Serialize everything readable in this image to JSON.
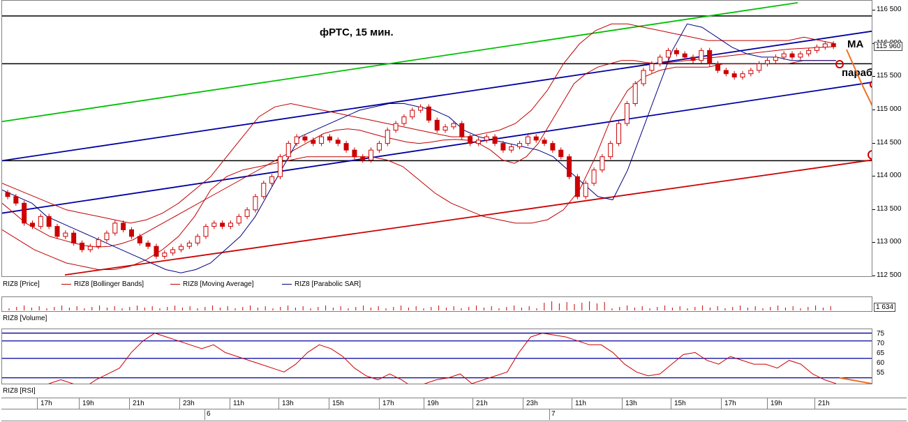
{
  "chart_data": [
    {
      "type": "candlestick",
      "title": "фРТС, 15 мин.",
      "instrument": "RIZ8",
      "ylim": [
        112500,
        116650
      ],
      "yticks": [
        "116 500",
        "116 000",
        "115 500",
        "115 000",
        "114 500",
        "114 000",
        "113 500",
        "113 000",
        "112 500"
      ],
      "ytick_values": [
        116500,
        116000,
        115500,
        115000,
        114500,
        114000,
        113500,
        113000,
        112500
      ],
      "last_value": "115 960",
      "legend": [
        "RIZ8 [Price]",
        "RIZ8 [Bollinger Bands]",
        "RIZ8 [Moving Average]",
        "RIZ8 [Parabolic SAR]"
      ],
      "annotations": [
        "MA",
        "параболик"
      ],
      "close_series": [
        113700,
        113600,
        113300,
        113250,
        113400,
        113250,
        113100,
        113150,
        113000,
        112900,
        112950,
        113050,
        113150,
        113300,
        113200,
        113100,
        113000,
        112950,
        112800,
        112850,
        112900,
        112950,
        113000,
        113100,
        113250,
        113300,
        113250,
        113300,
        113400,
        113500,
        113700,
        113900,
        114000,
        114300,
        114500,
        114600,
        114550,
        114500,
        114600,
        114550,
        114500,
        114400,
        114300,
        114250,
        114400,
        114500,
        114700,
        114800,
        114900,
        115000,
        115050,
        114850,
        114700,
        114750,
        114800,
        114600,
        114500,
        114550,
        114600,
        114500,
        114400,
        114450,
        114500,
        114600,
        114550,
        114500,
        114400,
        114300,
        114000,
        113700,
        113900,
        114100,
        114300,
        114500,
        114800,
        115100,
        115400,
        115600,
        115700,
        115800,
        115900,
        115850,
        115800,
        115750,
        115900,
        115700,
        115600,
        115550,
        115500,
        115550,
        115600,
        115700,
        115750,
        115800,
        115850,
        115800,
        115850,
        115900,
        115950,
        116000,
        115960
      ],
      "series": [
        {
          "name": "RIZ8 [Moving Average]",
          "color": "#c00000",
          "values": [
            113600,
            113450,
            113300,
            113200,
            113100,
            113050,
            113000,
            112960,
            112940,
            112950,
            112990,
            113050,
            113150,
            113250,
            113350,
            113450,
            113550,
            113650,
            113750,
            113850,
            113950,
            114050,
            114150,
            114250,
            114350,
            114450,
            114550,
            114650,
            114700,
            114720,
            114700,
            114650,
            114600,
            114560,
            114520,
            114500,
            114520,
            114550,
            114560,
            114550,
            114500,
            114400,
            114250,
            114200,
            114300,
            114500,
            114800,
            115100,
            115400,
            115550,
            115650,
            115700,
            115750,
            115750,
            115720,
            115700,
            115720,
            115740,
            115760,
            115780,
            115800,
            115820,
            115840,
            115860,
            115880,
            115900,
            115920,
            115930,
            115940,
            115950,
            115960
          ]
        },
        {
          "name": "RIZ8 [Bollinger Bands] upper",
          "color": "#c00000",
          "values": [
            113900,
            113800,
            113700,
            113600,
            113500,
            113450,
            113400,
            113350,
            113300,
            113350,
            113450,
            113600,
            113800,
            114000,
            114300,
            114600,
            114900,
            115050,
            115100,
            115050,
            115000,
            114950,
            114900,
            114850,
            114800,
            114750,
            114700,
            114650,
            114600,
            114600,
            114650,
            114700,
            114800,
            115000,
            115300,
            115700,
            116000,
            116200,
            116300,
            116300,
            116250,
            116200,
            116150,
            116100,
            116050,
            116050,
            116050,
            116050,
            116050,
            116050,
            116100,
            116050,
            116000
          ]
        },
        {
          "name": "RIZ8 [Bollinger Bands] lower",
          "color": "#c00000",
          "values": [
            113200,
            113050,
            112900,
            112800,
            112700,
            112650,
            112600,
            112600,
            112650,
            112750,
            112900,
            113100,
            113400,
            113800,
            114000,
            114100,
            114150,
            114200,
            114250,
            114300,
            114300,
            114300,
            114300,
            114300,
            114250,
            114150,
            113950,
            113750,
            113600,
            113500,
            113400,
            113350,
            113300,
            113300,
            113350,
            113500,
            113800,
            114300,
            114900,
            115300,
            115500,
            115600,
            115650,
            115650,
            115650,
            115700,
            115700,
            115700,
            115700,
            115700,
            115750,
            115750,
            115750
          ]
        },
        {
          "name": "RIZ8 [Parabolic SAR]",
          "color": "#000080",
          "values": [
            113800,
            113700,
            113600,
            113400,
            113300,
            113200,
            113100,
            113000,
            112900,
            112800,
            112700,
            112600,
            112550,
            112600,
            112700,
            112900,
            113100,
            113400,
            113800,
            114200,
            114600,
            114700,
            114800,
            114900,
            115000,
            115050,
            115100,
            115100,
            115050,
            115000,
            114900,
            114700,
            114600,
            114550,
            114500,
            114450,
            114400,
            114300,
            114100,
            113900,
            113700,
            113650,
            114100,
            114700,
            115300,
            115900,
            116300,
            116250,
            116100,
            115950,
            115850,
            115800,
            115800,
            115750,
            115750,
            115750,
            115750
          ]
        }
      ]
    },
    {
      "type": "bar",
      "title": "RIZ8 [Volume]",
      "last_value": "1 634"
    },
    {
      "type": "line",
      "title": "RIZ8 [RSI]",
      "ylim": [
        50,
        78
      ],
      "yticks": [
        "75",
        "70",
        "65",
        "60",
        "55"
      ],
      "ytick_values": [
        75,
        70,
        65,
        60,
        55
      ],
      "levels": [
        76,
        72,
        63,
        53
      ],
      "values": [
        48,
        46,
        45,
        47,
        50,
        52,
        50,
        48,
        52,
        55,
        58,
        66,
        72,
        76,
        74,
        72,
        70,
        68,
        70,
        66,
        64,
        62,
        60,
        58,
        56,
        60,
        66,
        70,
        68,
        64,
        58,
        54,
        52,
        55,
        52,
        48,
        50,
        52,
        53,
        55,
        50,
        52,
        54,
        56,
        66,
        74,
        76,
        75,
        74,
        72,
        70,
        70,
        66,
        60,
        56,
        54,
        55,
        60,
        65,
        66,
        62,
        60,
        64,
        62,
        60,
        60,
        58,
        62,
        60,
        55,
        52,
        50
      ]
    }
  ],
  "x_axis": {
    "ticks": [
      "17h",
      "19h",
      "21h",
      "23h",
      "11h",
      "13h",
      "15h",
      "17h",
      "19h",
      "21h",
      "23h",
      "11h",
      "13h",
      "15h",
      "17h",
      "19h",
      "21h"
    ],
    "days": [
      "6",
      "7"
    ]
  },
  "colors": {
    "up_candle": "#ffffff",
    "down_candle": "#cc0000",
    "channel": "#0000a0",
    "upper_trend": "#00c000",
    "support": "#cc0000",
    "forecast": "#f07020"
  }
}
